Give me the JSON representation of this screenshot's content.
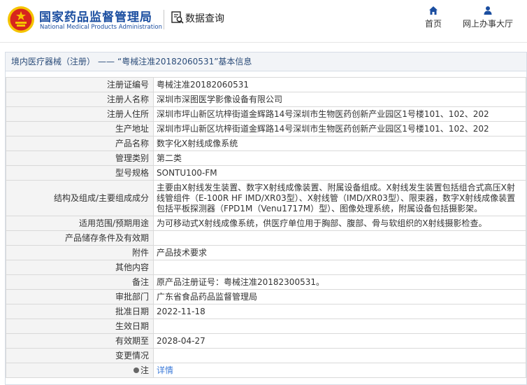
{
  "header": {
    "brand_cn": "国家药品监督管理局",
    "brand_en": "National Medical Products Administration",
    "query_title": "数据查询",
    "nav_home": "首页",
    "nav_online": "网上办事大厅"
  },
  "panel": {
    "crumb": "境内医疗器械（注册）",
    "separator": "——",
    "title": "“粤械注准20182060531”基本信息"
  },
  "rows": [
    {
      "label": "注册证编号",
      "value": "粤械注准20182060531"
    },
    {
      "label": "注册人名称",
      "value": "深圳市深图医学影像设备有限公司"
    },
    {
      "label": "注册人住所",
      "value": "深圳市坪山新区坑梓街道金辉路14号深圳市生物医药创新产业园区1号楼101、102、202"
    },
    {
      "label": "生产地址",
      "value": "深圳市坪山新区坑梓街道金辉路14号深圳市生物医药创新产业园区1号楼101、102、202"
    },
    {
      "label": "产品名称",
      "value": "数字化X射线成像系统"
    },
    {
      "label": "管理类别",
      "value": "第二类"
    },
    {
      "label": "型号规格",
      "value": "SONTU100-FM"
    },
    {
      "label": "结构及组成/主要组成成分",
      "value": "主要由X射线发生装置、数字X射线成像装置、附属设备组成。X射线发生装置包括组合式高压X射线管组件（E-100R HF IMD/XR03型）、X射线管（IMD/XR03型）、限束器，数字X射线成像装置包括平板探测器（FPD1M（Venu1717M）型）、图像处理系统，附属设备包括摄影架。"
    },
    {
      "label": "适用范围/预期用途",
      "value": "为可移动式X射线成像系统，供医疗单位用于胸部、腹部、骨与软组织的X射线摄影检查。"
    },
    {
      "label": "产品储存条件及有效期",
      "value": ""
    },
    {
      "label": "附件",
      "value": "产品技术要求"
    },
    {
      "label": "其他内容",
      "value": ""
    },
    {
      "label": "备注",
      "value": "原产品注册证号：粤械注准20182300531。"
    },
    {
      "label": "审批部门",
      "value": "广东省食品药品监督管理局"
    },
    {
      "label": "批准日期",
      "value": "2022-11-18"
    },
    {
      "label": "生效日期",
      "value": ""
    },
    {
      "label": "有效期至",
      "value": "2028-04-27"
    },
    {
      "label": "变更情况",
      "value": ""
    }
  ],
  "note": {
    "label": "注",
    "link": "详情"
  },
  "colors": {
    "brand": "#1b4ea0",
    "link": "#3d7bd9",
    "emblem_red": "#d7251d",
    "emblem_gold": "#f5c400"
  }
}
